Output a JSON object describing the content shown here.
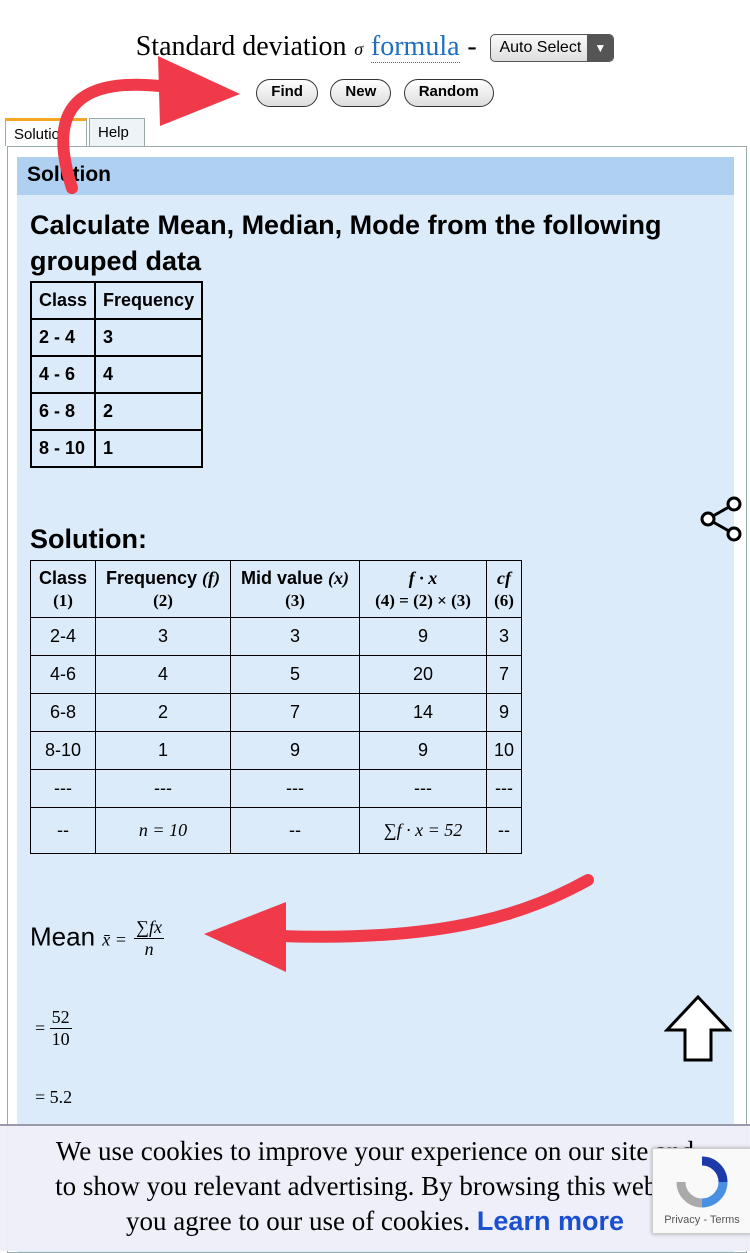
{
  "header": {
    "title_prefix": "Standard deviation",
    "sigma": "σ",
    "formula_link": "formula",
    "dash": "-",
    "select_value": "Auto Select",
    "buttons": {
      "find": "Find",
      "new": "New",
      "random": "Random"
    }
  },
  "tabs": [
    {
      "label": "Solution"
    },
    {
      "label": "Help"
    }
  ],
  "solution_bar": "Solution",
  "question_title": "Calculate Mean, Median, Mode from the following grouped data",
  "input_table": {
    "headers": [
      "Class",
      "Frequency"
    ],
    "rows": [
      [
        "2 - 4",
        "3"
      ],
      [
        "4 - 6",
        "4"
      ],
      [
        "6 - 8",
        "2"
      ],
      [
        "8 - 10",
        "1"
      ]
    ]
  },
  "solution_heading": "Solution:",
  "solution_table": {
    "headers": [
      {
        "label": "Class",
        "sub": "(1)"
      },
      {
        "label": "Frequency",
        "var": "(f)",
        "sub": "(2)"
      },
      {
        "label": "Mid value",
        "var": "(x)",
        "sub": "(3)"
      },
      {
        "label": "f · x",
        "sub": "(4) = (2) × (3)"
      },
      {
        "label": "cf",
        "sub": "(6)"
      }
    ],
    "rows": [
      [
        "2-4",
        "3",
        "3",
        "9",
        "3"
      ],
      [
        "4-6",
        "4",
        "5",
        "20",
        "7"
      ],
      [
        "6-8",
        "2",
        "7",
        "14",
        "9"
      ],
      [
        "8-10",
        "1",
        "9",
        "9",
        "10"
      ],
      [
        "---",
        "---",
        "---",
        "---",
        "---"
      ],
      [
        "--",
        "n = 10",
        "--",
        "∑f · x = 52",
        "--"
      ]
    ]
  },
  "mean": {
    "label": "Mean",
    "symbol": "x̄ =",
    "numerator": "∑fx",
    "denominator": "n",
    "step1_eq": "=",
    "step1_num": "52",
    "step1_den": "10",
    "result": "= 5.2"
  },
  "cookie": {
    "line1": "We use cookies to improve your experience on our site and",
    "line2": "to show you relevant advertising. By browsing this website",
    "line3": "you agree to our use of cookies.",
    "learn_more": "Learn more"
  },
  "recaptcha": {
    "label": "Privacy - Terms"
  },
  "colors": {
    "accent_arrow": "#f03a4a",
    "link": "#1f6fbf",
    "panel_bg": "#dcebfa",
    "bar_bg": "#afd0f0"
  }
}
